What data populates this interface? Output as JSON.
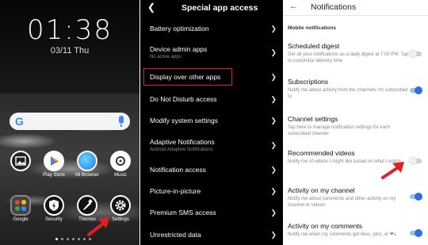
{
  "home": {
    "time": "01:38",
    "date": "03/11 Thu",
    "google_letter": "G",
    "row1": [
      {
        "label": "",
        "icon": "gallery-icon"
      },
      {
        "label": "Play Store",
        "icon": "play-store-icon"
      },
      {
        "label": "Mi Browser",
        "icon": "mi-browser-icon"
      },
      {
        "label": "Music",
        "icon": "music-icon"
      }
    ],
    "row2": [
      {
        "label": "Google",
        "icon": "google-folder-icon"
      },
      {
        "label": "Security",
        "icon": "security-icon"
      },
      {
        "label": "Themes",
        "icon": "themes-icon"
      },
      {
        "label": "Settings",
        "icon": "settings-icon"
      }
    ]
  },
  "special_access": {
    "title": "Special app access",
    "items": [
      {
        "label": "Battery optimization",
        "sub": ""
      },
      {
        "label": "Device admin apps",
        "sub": "No active apps"
      },
      {
        "label": "Display over other apps",
        "sub": ""
      },
      {
        "label": "Do Not Disturb access",
        "sub": ""
      },
      {
        "label": "Modify system settings",
        "sub": ""
      },
      {
        "label": "Adaptive Notifications",
        "sub": "Android Adaptive Notifications"
      },
      {
        "label": "Notification access",
        "sub": ""
      },
      {
        "label": "Picture-in-picture",
        "sub": ""
      },
      {
        "label": "Premium SMS access",
        "sub": ""
      },
      {
        "label": "Unrestricted data",
        "sub": ""
      }
    ]
  },
  "notifications": {
    "title": "Notifications",
    "section": "Mobile notifications",
    "items": [
      {
        "label": "Scheduled digest",
        "sub": "Get all your notifications as a daily digest at 7:00 PM. Tap to customize delivery time",
        "toggle": "off"
      },
      {
        "label": "Subscriptions",
        "sub": "Notify me about activity from the channels I'm subscribed to",
        "toggle": "on"
      },
      {
        "label": "Channel settings",
        "sub": "Tap here to manage notification settings for each subscribed channel",
        "toggle": ""
      },
      {
        "label": "Recommended videos",
        "sub": "Notify me of videos I might like based on what I watch",
        "toggle": "off"
      },
      {
        "label": "Activity on my channel",
        "sub": "Notify me about comments and other activity on my channel or videos",
        "toggle": "on"
      },
      {
        "label": "Activity on my comments",
        "sub": "Notify me when my comments get likes, pins, or ❤s",
        "toggle": "on"
      }
    ]
  },
  "colors": {
    "highlight": "#e02020",
    "toggle_on": "#2f6fe0",
    "arrow": "#e02020"
  }
}
